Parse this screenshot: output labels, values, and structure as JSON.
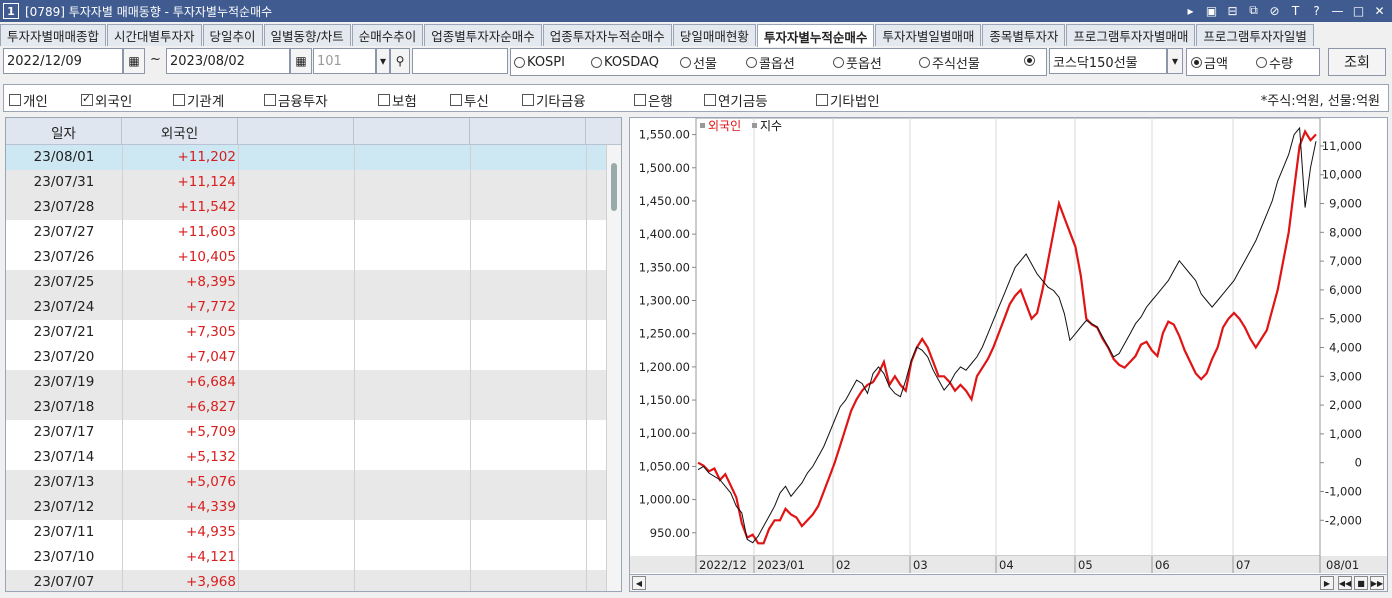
{
  "window": {
    "num": "1",
    "title": "[0789] 투자자별 매매동향 - 투자자별누적순매수"
  },
  "tabs": [
    "투자자별매매종합",
    "시간대별투자자",
    "당일추이",
    "일별동향/차트",
    "순매수추이",
    "업종별투자자순매수",
    "업종투자자누적순매수",
    "당일매매현황",
    "투자자별누적순매수",
    "투자자별일별매매",
    "종목별투자자",
    "프로그램투자자별매매",
    "프로그램투자자일별"
  ],
  "active_tab": 8,
  "controls": {
    "from": "2022/12/09",
    "tilde": "~",
    "to": "2023/08/02",
    "code": "101",
    "search": "",
    "radios1": [
      "KOSPI",
      "KOSDAQ",
      "선물",
      "콜옵션",
      "풋옵션",
      "주식선물"
    ],
    "selected_market": "코스닥150선물",
    "radios2": [
      "금액",
      "수량"
    ],
    "query_button": "조회"
  },
  "checks": [
    {
      "label": "개인",
      "on": false
    },
    {
      "label": "외국인",
      "on": true
    },
    {
      "label": "기관계",
      "on": false
    },
    {
      "label": "금융투자",
      "on": false
    },
    {
      "label": "보험",
      "on": false
    },
    {
      "label": "투신",
      "on": false
    },
    {
      "label": "기타금융",
      "on": false
    },
    {
      "label": "은행",
      "on": false
    },
    {
      "label": "연기금등",
      "on": false
    },
    {
      "label": "기타법인",
      "on": false
    }
  ],
  "unit_note": "*주식:억원, 선물:억원",
  "table": {
    "headers": [
      "일자",
      "외국인"
    ],
    "rows": [
      [
        "23/08/01",
        "+11,202"
      ],
      [
        "23/07/31",
        "+11,124"
      ],
      [
        "23/07/28",
        "+11,542"
      ],
      [
        "23/07/27",
        "+11,603"
      ],
      [
        "23/07/26",
        "+10,405"
      ],
      [
        "23/07/25",
        "+8,395"
      ],
      [
        "23/07/24",
        "+7,772"
      ],
      [
        "23/07/21",
        "+7,305"
      ],
      [
        "23/07/20",
        "+7,047"
      ],
      [
        "23/07/19",
        "+6,684"
      ],
      [
        "23/07/18",
        "+6,827"
      ],
      [
        "23/07/17",
        "+5,709"
      ],
      [
        "23/07/14",
        "+5,132"
      ],
      [
        "23/07/13",
        "+5,076"
      ],
      [
        "23/07/12",
        "+4,339"
      ],
      [
        "23/07/11",
        "+4,935"
      ],
      [
        "23/07/10",
        "+4,121"
      ],
      [
        "23/07/07",
        "+3,968"
      ]
    ]
  },
  "colors": {
    "foreign": "#e01414",
    "index": "#111111"
  },
  "chart_data": {
    "type": "line",
    "legend": [
      "외국인",
      "지수"
    ],
    "x_ticks": [
      "2022/12",
      "2023/01",
      "02",
      "03",
      "04",
      "05",
      "06",
      "07",
      "08/01"
    ],
    "left_axis": {
      "ticks": [
        "950.00",
        "1,000.00",
        "1,050.00",
        "1,100.00",
        "1,150.00",
        "1,200.00",
        "1,250.00",
        "1,300.00",
        "1,350.00",
        "1,400.00",
        "1,450.00",
        "1,500.00",
        "1,550.00"
      ],
      "min": 915,
      "max": 1575
    },
    "right_axis": {
      "ticks": [
        "-2,000",
        "-1,000",
        "0",
        "1,000",
        "2,000",
        "3,000",
        "4,000",
        "5,000",
        "6,000",
        "7,000",
        "8,000",
        "9,000",
        "10,000",
        "11,000"
      ],
      "min": -3240,
      "max": 11970
    },
    "series": [
      {
        "name": "외국인",
        "axis": "right",
        "values": [
          0,
          -100,
          -300,
          -200,
          -600,
          -400,
          -800,
          -1200,
          -2100,
          -2600,
          -2500,
          -2800,
          -2800,
          -2300,
          -2000,
          -2000,
          -1600,
          -1800,
          -1900,
          -2200,
          -2000,
          -1800,
          -1500,
          -1000,
          -500,
          0,
          600,
          1200,
          1800,
          2200,
          2500,
          2700,
          2800,
          3100,
          3500,
          2700,
          3000,
          2700,
          2500,
          3500,
          4000,
          4300,
          4000,
          3500,
          3000,
          3000,
          2800,
          2500,
          2700,
          2500,
          2200,
          3000,
          3300,
          3600,
          4000,
          4500,
          5000,
          5500,
          5800,
          6000,
          5500,
          5000,
          5200,
          6000,
          7000,
          8000,
          9000,
          8500,
          8000,
          7500,
          6500,
          5000,
          4800,
          4700,
          4300,
          4000,
          3600,
          3400,
          3300,
          3500,
          3700,
          4100,
          4200,
          3900,
          3700,
          4500,
          4900,
          4800,
          4400,
          3900,
          3500,
          3100,
          2900,
          3100,
          3600,
          4000,
          4700,
          5000,
          5200,
          5000,
          4700,
          4300,
          4000,
          4300,
          4600,
          5300,
          6000,
          7000,
          8000,
          9500,
          11000,
          11500,
          11200,
          11400
        ]
      },
      {
        "name": "지수",
        "axis": "left",
        "values": [
          1045,
          1050,
          1040,
          1035,
          1030,
          1020,
          1010,
          990,
          980,
          940,
          935,
          945,
          960,
          975,
          990,
          1010,
          1020,
          1005,
          1015,
          1025,
          1040,
          1050,
          1065,
          1080,
          1100,
          1120,
          1140,
          1150,
          1165,
          1180,
          1175,
          1160,
          1190,
          1200,
          1190,
          1170,
          1160,
          1155,
          1180,
          1210,
          1230,
          1225,
          1215,
          1195,
          1180,
          1165,
          1175,
          1190,
          1200,
          1195,
          1205,
          1215,
          1230,
          1250,
          1270,
          1290,
          1310,
          1330,
          1350,
          1360,
          1370,
          1355,
          1340,
          1330,
          1320,
          1315,
          1305,
          1280,
          1240,
          1250,
          1260,
          1270,
          1265,
          1260,
          1245,
          1230,
          1215,
          1220,
          1235,
          1250,
          1265,
          1275,
          1290,
          1300,
          1310,
          1320,
          1330,
          1345,
          1360,
          1350,
          1340,
          1330,
          1310,
          1300,
          1290,
          1300,
          1310,
          1320,
          1330,
          1345,
          1360,
          1375,
          1390,
          1410,
          1430,
          1450,
          1480,
          1500,
          1520,
          1550,
          1560,
          1440,
          1500,
          1540
        ]
      }
    ]
  }
}
